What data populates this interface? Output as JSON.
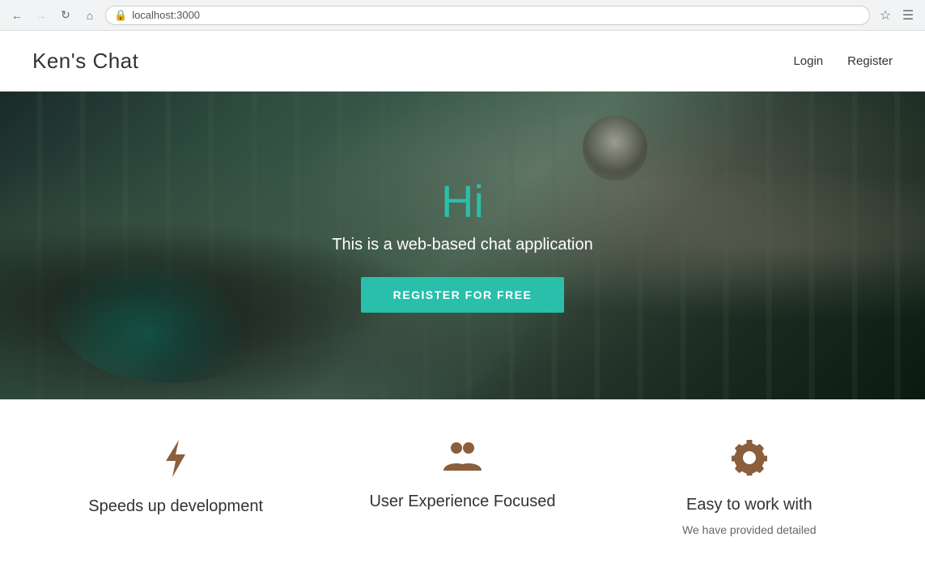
{
  "browser": {
    "url": "localhost:3000",
    "back_disabled": false,
    "forward_disabled": true
  },
  "navbar": {
    "brand": "Ken's Chat",
    "links": [
      {
        "id": "login",
        "label": "Login"
      },
      {
        "id": "register",
        "label": "Register"
      }
    ]
  },
  "hero": {
    "greeting": "Hi",
    "tagline": "This is a web-based chat application",
    "cta_button": "REGISTER FOR FREE"
  },
  "features": [
    {
      "id": "speed",
      "icon_name": "bolt-icon",
      "title": "Speeds up development",
      "description": ""
    },
    {
      "id": "ux",
      "icon_name": "users-icon",
      "title": "User Experience Focused",
      "description": ""
    },
    {
      "id": "easy",
      "icon_name": "gear-icon",
      "title": "Easy to work with",
      "description": "We have provided detailed"
    }
  ],
  "colors": {
    "teal": "#2abfaa",
    "brown_icon": "#8b5e3c",
    "brand_text": "#333"
  }
}
